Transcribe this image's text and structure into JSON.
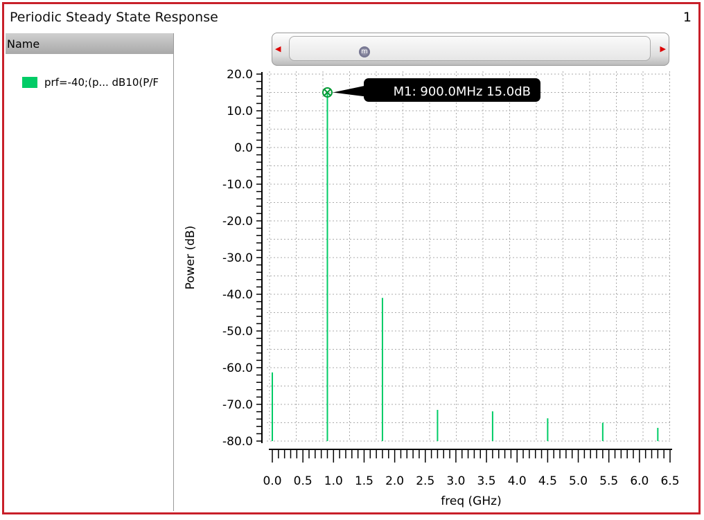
{
  "window": {
    "title": "Periodic Steady State Response",
    "number": "1"
  },
  "left_panel": {
    "header": "Name",
    "trace_label": "prf=-40;(p... dB10(P/F",
    "trace_color": "#00cc66"
  },
  "marker": {
    "label": "M1: 900.0MHz 15.0dB",
    "x": 0.9,
    "y": 15.0,
    "icon": "m"
  },
  "chart_data": {
    "type": "bar",
    "title": "",
    "xlabel": "freq (GHz)",
    "ylabel": "Power (dB)",
    "xlim": [
      0,
      6.5
    ],
    "ylim": [
      -80,
      20
    ],
    "xticks": [
      "0.0",
      "0.5",
      "1.0",
      "1.5",
      "2.0",
      "2.5",
      "3.0",
      "3.5",
      "4.0",
      "4.5",
      "5.0",
      "5.5",
      "6.0",
      "6.5"
    ],
    "yticks": [
      "20.0",
      "10.0",
      "0.0",
      "-10.0",
      "-20.0",
      "-30.0",
      "-40.0",
      "-50.0",
      "-60.0",
      "-70.0",
      "-80.0"
    ],
    "grid": true,
    "series": [
      {
        "name": "prf=-40;(p... dB10(P/F",
        "x": [
          0.0,
          0.9,
          1.8,
          2.7,
          3.6,
          4.5,
          5.4,
          6.3
        ],
        "values": [
          -61.3,
          15.0,
          -41.0,
          -71.5,
          -71.9,
          -73.8,
          -75.0,
          -76.4
        ]
      }
    ]
  }
}
